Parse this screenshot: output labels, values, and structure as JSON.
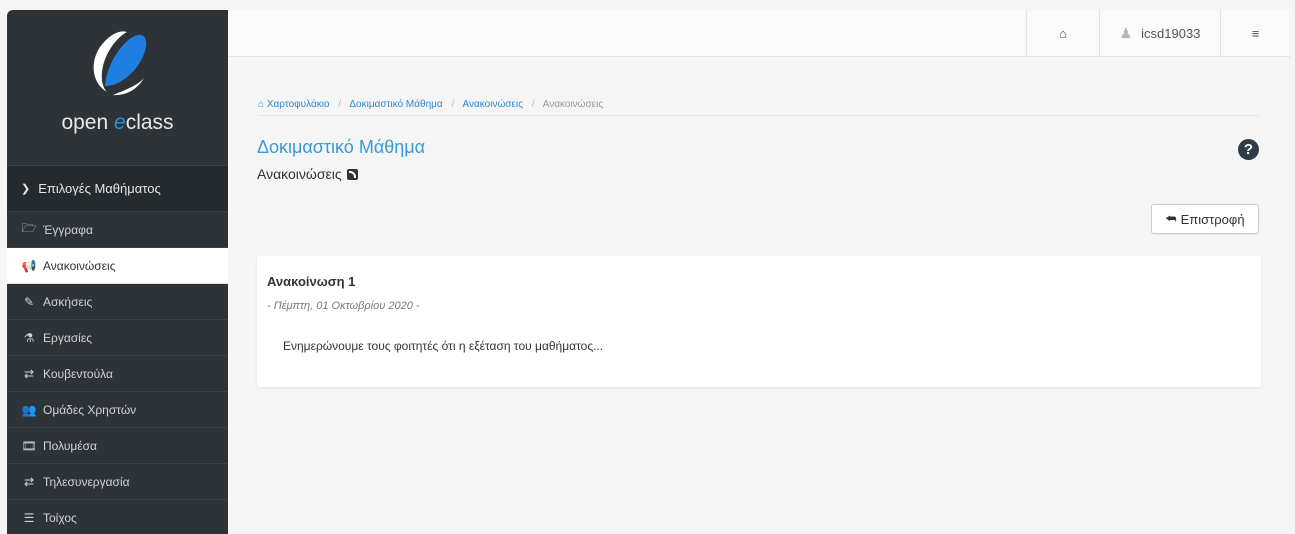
{
  "app": {
    "logo_text_pre": "open ",
    "logo_text_accent": "e",
    "logo_text_post": "class"
  },
  "sidebar": {
    "section_label": "Επιλογές Μαθήματος",
    "items": [
      {
        "label": "Έγγραφα",
        "icon": "folder-icon",
        "glyph": "🗁"
      },
      {
        "label": "Ανακοινώσεις",
        "icon": "bullhorn-icon",
        "glyph": "📢",
        "active": true
      },
      {
        "label": "Ασκήσεις",
        "icon": "edit-icon",
        "glyph": "✎"
      },
      {
        "label": "Εργασίες",
        "icon": "flask-icon",
        "glyph": "⚗"
      },
      {
        "label": "Κουβεντούλα",
        "icon": "exchange-icon",
        "glyph": "⇄"
      },
      {
        "label": "Ομάδες Χρηστών",
        "icon": "users-icon",
        "glyph": "👥"
      },
      {
        "label": "Πολυμέσα",
        "icon": "film-icon",
        "glyph": "🎞"
      },
      {
        "label": "Τηλεσυνεργασία",
        "icon": "exchange-icon",
        "glyph": "⇄"
      },
      {
        "label": "Τοίχος",
        "icon": "list-icon",
        "glyph": "☰"
      }
    ]
  },
  "header": {
    "username": "icsd19033"
  },
  "breadcrumb": {
    "items": [
      "Χαρτοφυλάκιο",
      "Δοκιμαστικό Μάθημα",
      "Ανακοινώσεις"
    ],
    "current": "Ανακοινώσεις"
  },
  "page": {
    "course_title": "Δοκιμαστικό Μάθημα",
    "section_title": "Ανακοινώσεις",
    "help_label": "?",
    "back_label": "Επιστροφή"
  },
  "announcement": {
    "title": "Ανακοίνωση 1",
    "date": "- Πέμπτη, 01 Οκτωβρίου 2020 -",
    "body": "Ενημερώνουμε τους φοιτητές ότι η εξέταση του μαθήματος..."
  }
}
